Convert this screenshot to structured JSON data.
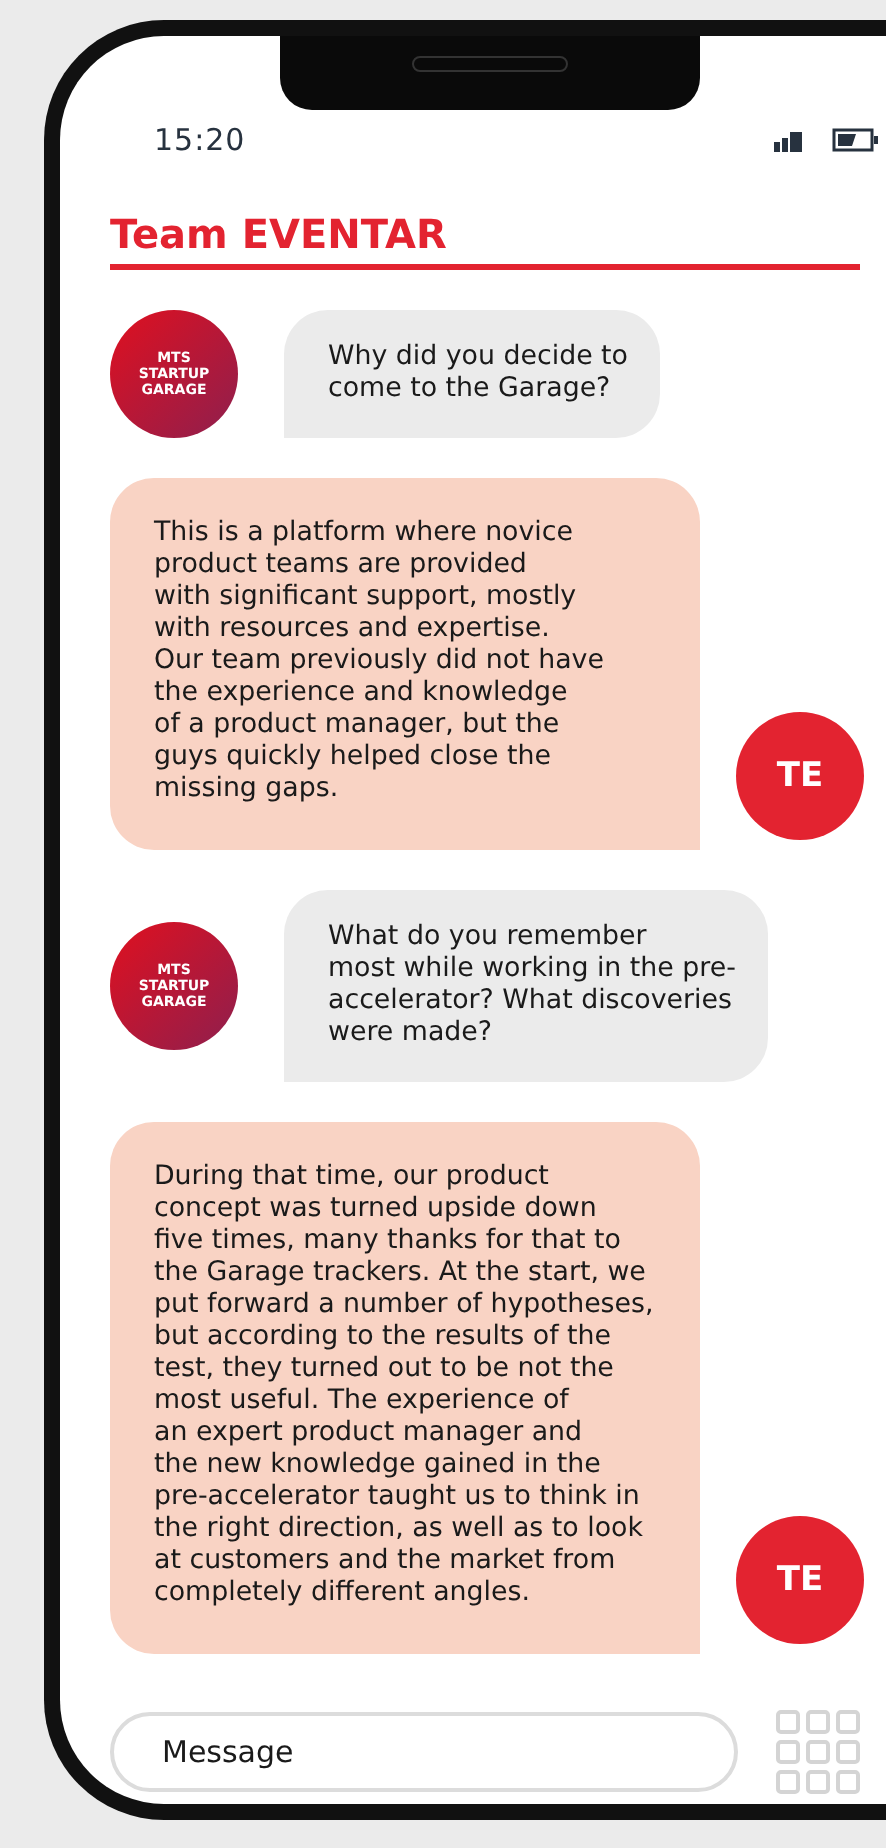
{
  "status_bar": {
    "time": "15:20"
  },
  "header": {
    "title": "Team EVENTAR"
  },
  "messages": [
    {
      "kind": "question",
      "avatar": "MTS\nSTARTUP\nGARAGE",
      "text": "Why did you decide to\ncome to the Garage?"
    },
    {
      "kind": "answer",
      "avatar": "TE",
      "text": "This is a platform where novice\nproduct teams are provided\nwith significant support, mostly\nwith resources and expertise.\nOur team previously did not have\nthe experience and knowledge\nof a product manager, but the\nguys quickly helped close the\nmissing gaps."
    },
    {
      "kind": "question",
      "avatar": "MTS\nSTARTUP\nGARAGE",
      "text": "What do you remember\nmost while working in the pre-\naccelerator? What discoveries\nwere made?"
    },
    {
      "kind": "answer",
      "avatar": "TE",
      "text": "During that time, our product\nconcept was turned upside down\nfive times, many thanks for that to\nthe Garage trackers. At the start, we\nput forward a number of hypotheses,\nbut according to the results of the\ntest, they turned out to be not the\nmost useful. The experience of\nan expert product manager and\nthe new knowledge gained in the\npre-accelerator taught us to think in\nthe right direction, as well as to look\nat customers and the market from\ncompletely different angles."
    }
  ],
  "composer": {
    "placeholder": "Message"
  }
}
